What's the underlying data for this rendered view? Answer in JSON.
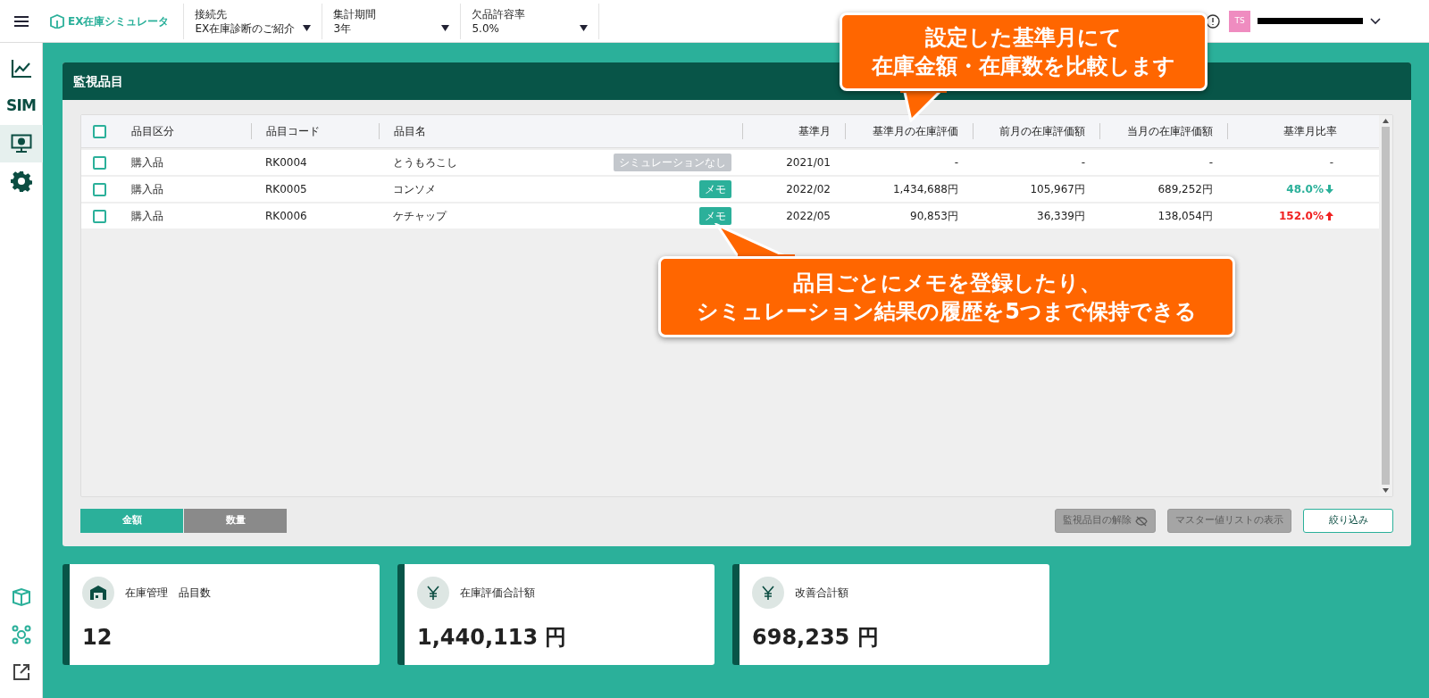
{
  "header": {
    "logo": "EX在庫シミュレータ",
    "selectors": [
      {
        "label": "接続先",
        "value": "EX在庫診断のご紹介"
      },
      {
        "label": "集計期間",
        "value": "3年"
      },
      {
        "label": "欠品許容率",
        "value": "5.0%"
      }
    ],
    "user": {
      "initials": "TS"
    }
  },
  "sidebar": {
    "items": [
      {
        "kind": "chart",
        "selected": false
      },
      {
        "kind": "sim",
        "label": "SIM",
        "selected": false
      },
      {
        "kind": "monitor",
        "selected": true
      },
      {
        "kind": "gear",
        "selected": false
      }
    ],
    "bottom": [
      {
        "kind": "box"
      },
      {
        "kind": "cog-network"
      },
      {
        "kind": "external"
      }
    ]
  },
  "panel": {
    "title": "監視品目",
    "table": {
      "all_checked": false,
      "columns": [
        "品目区分",
        "品目コード",
        "品目名",
        "基準月",
        "基準月の在庫評価",
        "前月の在庫評価額",
        "当月の在庫評価額",
        "基準月比率"
      ],
      "rows": [
        {
          "checked": false,
          "category": "購入品",
          "code": "RK0004",
          "name": "とうもろこし",
          "badge": {
            "kind": "none",
            "text": "シミュレーションなし"
          },
          "base_month": "2021/01",
          "base_value": "-",
          "prev_value": "-",
          "curr_value": "-",
          "ratio": "-",
          "kind": "flat"
        },
        {
          "checked": false,
          "category": "購入品",
          "code": "RK0005",
          "name": "コンソメ",
          "badge": {
            "kind": "memo",
            "text": "メモ"
          },
          "base_month": "2022/02",
          "base_value": "1,434,688円",
          "prev_value": "105,967円",
          "curr_value": "689,252円",
          "ratio": "48.0%",
          "kind": "down"
        },
        {
          "checked": false,
          "category": "購入品",
          "code": "RK0006",
          "name": "ケチャップ",
          "badge": {
            "kind": "memo",
            "text": "メモ"
          },
          "base_month": "2022/05",
          "base_value": "90,853円",
          "prev_value": "36,339円",
          "curr_value": "138,054円",
          "ratio": "152.0%",
          "kind": "up"
        }
      ]
    },
    "toggle": [
      {
        "label": "金額",
        "selected": true
      },
      {
        "label": "数量",
        "selected": false
      }
    ],
    "actions": [
      {
        "label": "監視品目の解除",
        "disabled": true
      },
      {
        "label": "マスター値リストの表示",
        "disabled": true
      },
      {
        "label": "絞り込み",
        "disabled": false
      }
    ]
  },
  "summary_cards": [
    {
      "label": "在庫管理　品目数",
      "value": "12"
    },
    {
      "label": "在庫評価合計額",
      "value": "1,440,113 円"
    },
    {
      "label": "改善合計額",
      "value": "698,235 円"
    }
  ],
  "callouts": [
    {
      "lines": [
        "設定した基準月にて",
        "在庫金額・在庫数を比較します"
      ]
    },
    {
      "lines": [
        "品目ごとにメモを登録したり、",
        "シミュレーション結果の履歴を5つまで保持できる"
      ]
    }
  ]
}
